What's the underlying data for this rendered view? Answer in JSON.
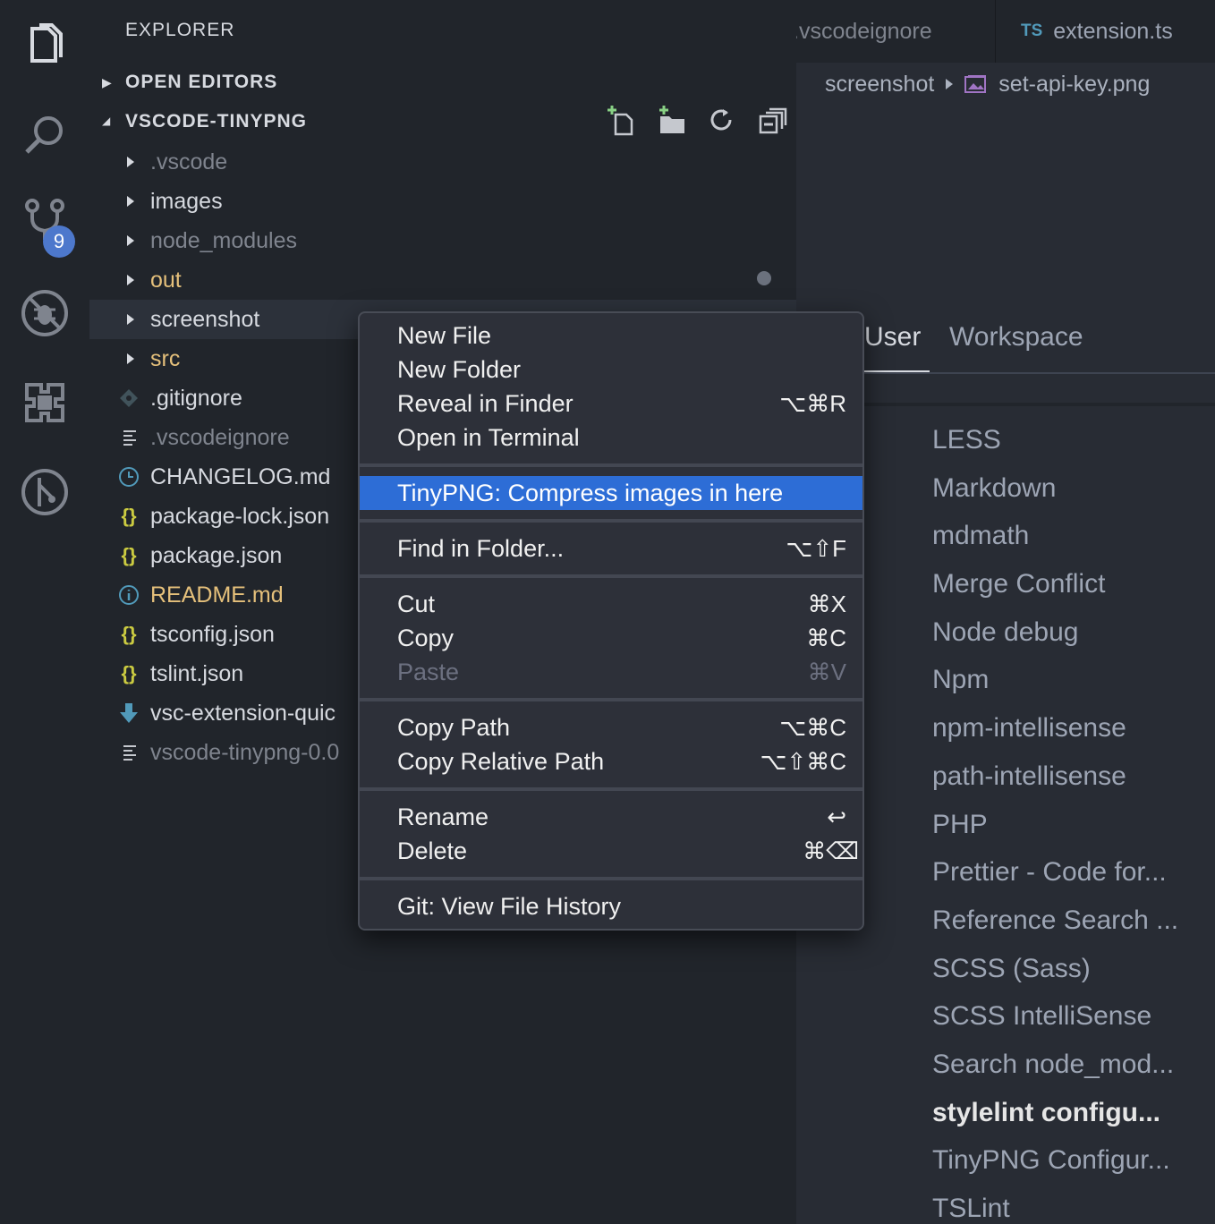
{
  "activity_bar": {
    "icons": [
      "explorer-icon",
      "search-icon",
      "source-control-icon",
      "debug-icon",
      "extensions-icon",
      "git-history-icon"
    ],
    "scm_badge": "9"
  },
  "sidebar": {
    "title": "EXPLORER",
    "open_editors": "OPEN EDITORS",
    "project": "VSCODE-TINYPNG",
    "toolbar": [
      "new-file-icon",
      "new-folder-icon",
      "refresh-icon",
      "collapse-all-icon"
    ],
    "tree": [
      {
        "name": ".vscode",
        "type": "folder"
      },
      {
        "name": "images",
        "type": "folder"
      },
      {
        "name": "node_modules",
        "type": "folder"
      },
      {
        "name": "out",
        "type": "folder"
      },
      {
        "name": "screenshot",
        "type": "folder"
      },
      {
        "name": "src",
        "type": "folder"
      },
      {
        "name": ".gitignore",
        "type": "file",
        "icon": "git-icon"
      },
      {
        "name": ".vscodeignore",
        "type": "file",
        "icon": "lines-icon"
      },
      {
        "name": "CHANGELOG.md",
        "type": "file",
        "icon": "clock-icon"
      },
      {
        "name": "package-lock.json",
        "type": "file",
        "icon": "{}"
      },
      {
        "name": "package.json",
        "type": "file",
        "icon": "{}"
      },
      {
        "name": "README.md",
        "type": "file",
        "icon": "info-icon"
      },
      {
        "name": "tsconfig.json",
        "type": "file",
        "icon": "{}"
      },
      {
        "name": "tslint.json",
        "type": "file",
        "icon": "{}"
      },
      {
        "name": "vsc-extension-quic",
        "type": "file",
        "icon": "download-icon"
      },
      {
        "name": "vscode-tinypng-0.0",
        "type": "file",
        "icon": "lines-icon"
      }
    ]
  },
  "tabs": {
    "tab1": ".vscodeignore",
    "tab2_badge": "TS",
    "tab2": "extension.ts"
  },
  "breadcrumb": {
    "folder": "screenshot",
    "file": "set-api-key.png"
  },
  "settings": {
    "tab_user": "User",
    "tab_workspace": "Workspace",
    "extensions": [
      "LESS",
      "Markdown",
      "mdmath",
      "Merge Conflict",
      "Node debug",
      "Npm",
      "npm-intellisense",
      "path-intellisense",
      "PHP",
      "Prettier - Code for...",
      "Reference Search ...",
      "SCSS (Sass)",
      "SCSS IntelliSense",
      "Search node_mod...",
      "stylelint configu...",
      "TinyPNG Configur...",
      "TSLint"
    ],
    "bold_item": "stylelint configu..."
  },
  "context_menu": {
    "new_file": "New File",
    "new_folder": "New Folder",
    "reveal": "Reveal in Finder",
    "reveal_sc": "⌥⌘R",
    "terminal": "Open in Terminal",
    "tinypng": "TinyPNG: Compress images in here",
    "find": "Find in Folder...",
    "find_sc": "⌥⇧F",
    "cut": "Cut",
    "cut_sc": "⌘X",
    "copy": "Copy",
    "copy_sc": "⌘C",
    "paste": "Paste",
    "paste_sc": "⌘V",
    "copy_path": "Copy Path",
    "copy_path_sc": "⌥⌘C",
    "copy_rel": "Copy Relative Path",
    "copy_rel_sc": "⌥⇧⌘C",
    "rename": "Rename",
    "rename_sc": "↩",
    "delete": "Delete",
    "delete_sc": "⌘⌫",
    "git_history": "Git: View File History"
  },
  "colors": {
    "menu_highlight": "#2d6dd6",
    "folder_yellow": "#e5c07b",
    "json_yellow": "#cbcb41",
    "info_blue": "#519aba"
  }
}
